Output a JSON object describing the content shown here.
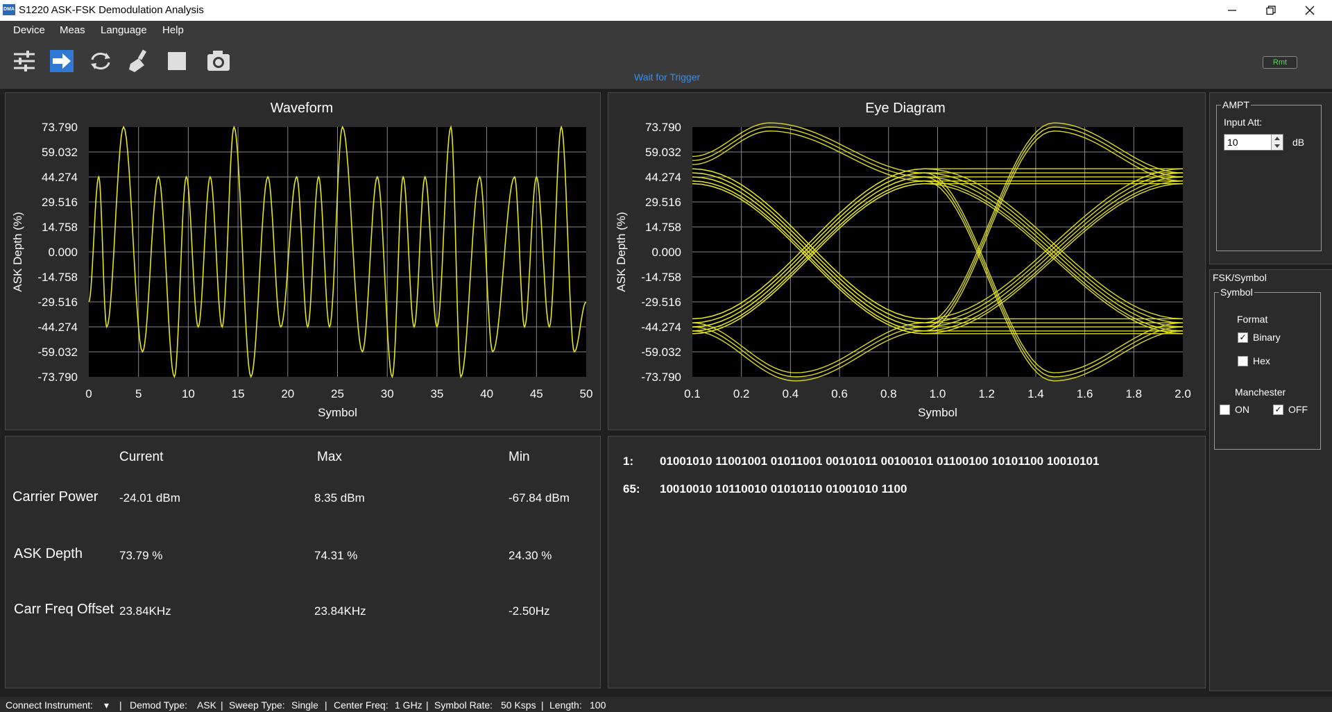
{
  "window": {
    "title": "S1220 ASK-FSK Demodulation Analysis",
    "icon_text": "DMA"
  },
  "menu": [
    "Device",
    "Meas",
    "Language",
    "Help"
  ],
  "toolbar": {
    "status": "Wait for Trigger",
    "remote_badge": "Rmt"
  },
  "waveform": {
    "title": "Waveform",
    "xlabel": "Symbol",
    "ylabel": "ASK Depth (%)",
    "yticks": [
      "73.790",
      "59.032",
      "44.274",
      "29.516",
      "14.758",
      "0.000",
      "-14.758",
      "-29.516",
      "-44.274",
      "-59.032",
      "-73.790"
    ],
    "xticks": [
      "0",
      "5",
      "10",
      "15",
      "20",
      "25",
      "30",
      "35",
      "40",
      "45",
      "50"
    ]
  },
  "eye": {
    "title": "Eye Diagram",
    "xlabel": "Symbol",
    "ylabel": "ASK Depth (%)",
    "yticks": [
      "73.790",
      "59.032",
      "44.274",
      "29.516",
      "14.758",
      "0.000",
      "-14.758",
      "-29.516",
      "-44.274",
      "-59.032",
      "-73.790"
    ],
    "xticks": [
      "0.1",
      "0.2",
      "0.4",
      "0.6",
      "0.8",
      "1.0",
      "1.2",
      "1.4",
      "1.6",
      "1.8",
      "2.0"
    ]
  },
  "chart_data": [
    {
      "type": "line",
      "title": "Waveform",
      "xlabel": "Symbol",
      "ylabel": "ASK Depth (%)",
      "xlim": [
        0,
        50
      ],
      "ylim": [
        -73.79,
        73.79
      ],
      "grid": true,
      "trace_color": "#e6e61e",
      "peaks": [
        {
          "x": 1.0,
          "y": 44.3
        },
        {
          "x": 1.8,
          "y": -44.3
        },
        {
          "x": 3.5,
          "y": 73.8
        },
        {
          "x": 5.4,
          "y": -59.0
        },
        {
          "x": 7.0,
          "y": 44.3
        },
        {
          "x": 8.6,
          "y": -73.8
        },
        {
          "x": 9.8,
          "y": 44.3
        },
        {
          "x": 11.0,
          "y": -44.3
        },
        {
          "x": 12.2,
          "y": 44.3
        },
        {
          "x": 13.4,
          "y": -44.3
        },
        {
          "x": 14.6,
          "y": 73.8
        },
        {
          "x": 16.3,
          "y": -73.8
        },
        {
          "x": 18.0,
          "y": 44.3
        },
        {
          "x": 19.3,
          "y": -44.3
        },
        {
          "x": 20.9,
          "y": 44.3
        },
        {
          "x": 22.0,
          "y": -44.3
        },
        {
          "x": 23.1,
          "y": 44.3
        },
        {
          "x": 24.2,
          "y": -44.3
        },
        {
          "x": 25.5,
          "y": 73.8
        },
        {
          "x": 27.5,
          "y": -59.0
        },
        {
          "x": 29.0,
          "y": 44.3
        },
        {
          "x": 30.5,
          "y": -73.8
        },
        {
          "x": 31.6,
          "y": 44.3
        },
        {
          "x": 32.7,
          "y": -44.3
        },
        {
          "x": 33.8,
          "y": 44.3
        },
        {
          "x": 35.0,
          "y": -44.3
        },
        {
          "x": 36.4,
          "y": 73.8
        },
        {
          "x": 37.4,
          "y": -73.8
        },
        {
          "x": 39.3,
          "y": 44.3
        },
        {
          "x": 40.6,
          "y": -59.0
        },
        {
          "x": 42.8,
          "y": 44.3
        },
        {
          "x": 43.8,
          "y": -44.3
        },
        {
          "x": 45.0,
          "y": 44.3
        },
        {
          "x": 46.3,
          "y": -44.3
        },
        {
          "x": 47.5,
          "y": 73.8
        },
        {
          "x": 48.8,
          "y": -59.0
        },
        {
          "x": 50.0,
          "y": -29.5
        }
      ]
    },
    {
      "type": "line",
      "title": "Eye Diagram",
      "xlabel": "Symbol",
      "ylabel": "ASK Depth (%)",
      "xlim": [
        0.1,
        2.0
      ],
      "ylim": [
        -73.79,
        73.79
      ],
      "grid": true,
      "trace_color": "#e6e61e",
      "series": [
        {
          "values": [
            {
              "x": 0.1,
              "y": 44.3
            },
            {
              "x": 1.0,
              "y": -44.3
            },
            {
              "x": 2.0,
              "y": 44.3
            }
          ]
        },
        {
          "values": [
            {
              "x": 0.1,
              "y": 44.3
            },
            {
              "x": 1.0,
              "y": -44.3
            },
            {
              "x": 2.0,
              "y": -44.3
            }
          ]
        },
        {
          "values": [
            {
              "x": 0.1,
              "y": -44.3
            },
            {
              "x": 1.0,
              "y": 44.3
            },
            {
              "x": 2.0,
              "y": -44.3
            }
          ]
        },
        {
          "values": [
            {
              "x": 0.1,
              "y": -44.3
            },
            {
              "x": 1.0,
              "y": 44.3
            },
            {
              "x": 2.0,
              "y": 44.3
            }
          ]
        },
        {
          "values": [
            {
              "x": 0.1,
              "y": 54
            },
            {
              "x": 0.4,
              "y": 73.8
            },
            {
              "x": 1.0,
              "y": 44.3
            }
          ]
        },
        {
          "values": [
            {
              "x": 0.1,
              "y": -44.3
            },
            {
              "x": 0.5,
              "y": -73.8
            },
            {
              "x": 1.0,
              "y": -44.3
            }
          ]
        },
        {
          "values": [
            {
              "x": 1.0,
              "y": -44.3
            },
            {
              "x": 1.5,
              "y": 73.8
            },
            {
              "x": 2.0,
              "y": 44.3
            }
          ]
        },
        {
          "values": [
            {
              "x": 1.0,
              "y": 44.3
            },
            {
              "x": 1.5,
              "y": -73.8
            },
            {
              "x": 2.0,
              "y": -44.3
            }
          ]
        }
      ]
    }
  ],
  "measurements": {
    "headers": [
      "Current",
      "Max",
      "Min"
    ],
    "rows": [
      {
        "label": "Carrier Power",
        "current": "-24.01 dBm",
        "max": "8.35 dBm",
        "min": "-67.84 dBm"
      },
      {
        "label": "ASK Depth",
        "current": "73.79 %",
        "max": "74.31 %",
        "min": "24.30 %"
      },
      {
        "label": "Carr Freq Offset",
        "current": "23.84KHz",
        "max": "23.84KHz",
        "min": "-2.50Hz"
      }
    ]
  },
  "bits": [
    {
      "index": "1:",
      "value": "01001010 11001001 01011001 00101011 00100101 01100100 10101100 10010101"
    },
    {
      "index": "65:",
      "value": "10010010 10110010 01010110 01001010 1100"
    }
  ],
  "ampt": {
    "group": "AMPT",
    "input_att_label": "Input Att:",
    "input_att_value": "10",
    "unit": "dB"
  },
  "fsk": {
    "section": "FSK/Symbol",
    "group": "Symbol",
    "format_label": "Format",
    "binary_label": "Binary",
    "binary_checked": true,
    "hex_label": "Hex",
    "hex_checked": false,
    "manchester_label": "Manchester",
    "on_label": "ON",
    "on_checked": false,
    "off_label": "OFF",
    "off_checked": true
  },
  "footer": {
    "connect": "Connect Instrument:",
    "demod_label": "Demod Type:",
    "demod": "ASK",
    "sweep_label": "Sweep Type:",
    "sweep": "Single",
    "freq_label": "Center Freq:",
    "freq": "1 GHz",
    "rate_label": "Symbol Rate:",
    "rate": "50 Ksps",
    "length_label": "Length:",
    "length": "100"
  }
}
